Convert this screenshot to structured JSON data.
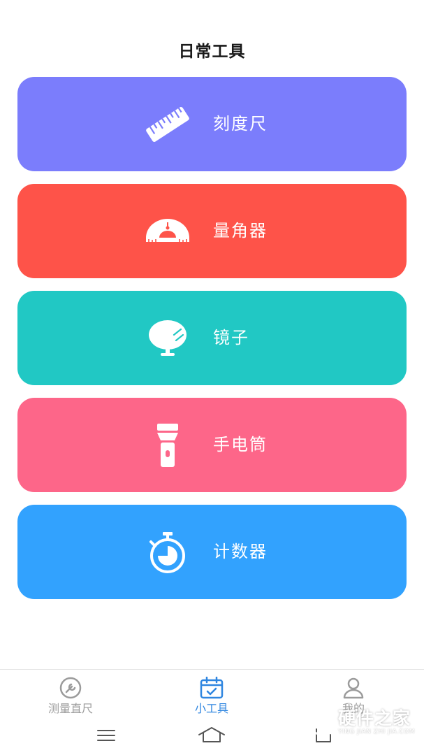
{
  "header": {
    "title": "日常工具"
  },
  "tools": [
    {
      "label": "刻度尺",
      "icon": "ruler-icon",
      "color": "#7b7dfc"
    },
    {
      "label": "量角器",
      "icon": "protractor-icon",
      "color": "#fe5349"
    },
    {
      "label": "镜子",
      "icon": "mirror-icon",
      "color": "#21c8c4"
    },
    {
      "label": "手电筒",
      "icon": "flashlight-icon",
      "color": "#fd6689"
    },
    {
      "label": "计数器",
      "icon": "stopwatch-icon",
      "color": "#32a2fe"
    }
  ],
  "bottom_nav": {
    "items": [
      {
        "label": "测量直尺",
        "icon": "wrench-icon",
        "active": false
      },
      {
        "label": "小工具",
        "icon": "calendar-check-icon",
        "active": true
      },
      {
        "label": "我的",
        "icon": "user-icon",
        "active": false
      }
    ],
    "active_color": "#2f86e0",
    "inactive_color": "#9b9b9b"
  },
  "system_bar": {
    "buttons": [
      "menu-icon",
      "home-icon",
      "back-icon"
    ]
  },
  "watermark": {
    "cn": "硬件之家",
    "en": "YING JIAN ZHI JIA.COM"
  }
}
